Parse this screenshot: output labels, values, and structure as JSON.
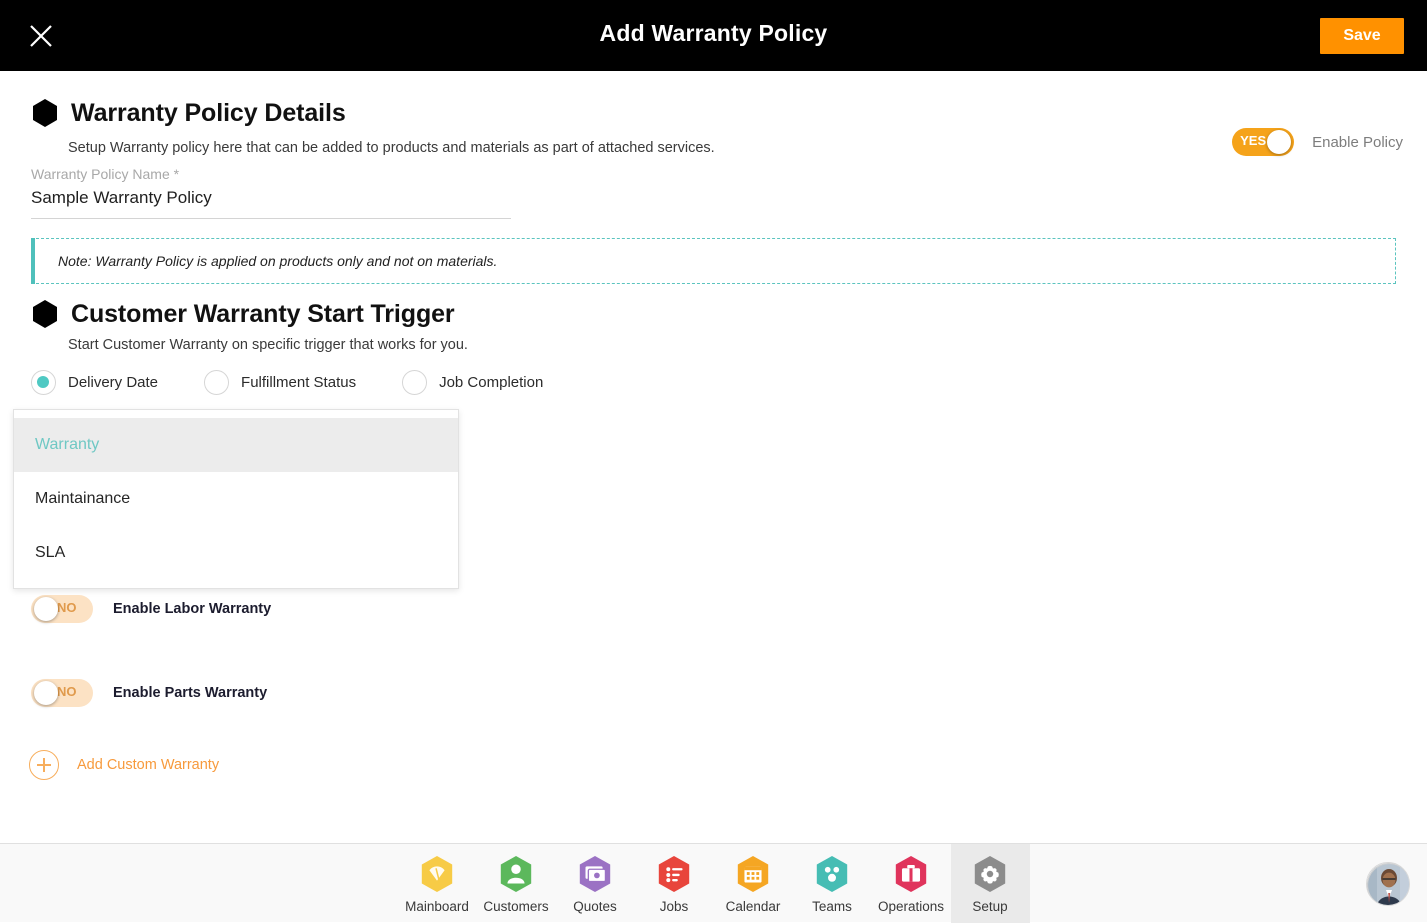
{
  "topbar": {
    "close_icon": "close-icon",
    "title": "Add Warranty Policy",
    "save_label": "Save"
  },
  "policy_details": {
    "heading": "Warranty Policy Details",
    "subtitle": "Setup Warranty policy here that can be added to products and materials as part of attached services.",
    "enable_toggle": {
      "state": "YES",
      "label": "Enable Policy"
    },
    "name_field": {
      "label": "Warranty Policy Name *",
      "value": "Sample Warranty Policy",
      "placeholder": "Warranty Policy Name"
    }
  },
  "note": {
    "text": "Note: Warranty Policy is applied on products only and not on materials.",
    "accent_color": "#4FC0BB"
  },
  "start_trigger": {
    "heading": "Customer Warranty Start Trigger",
    "subtitle": "Start Customer Warranty on specific trigger that works for you.",
    "options": [
      {
        "label": "Delivery Date",
        "selected": true
      },
      {
        "label": "Fulfillment Status",
        "selected": false
      },
      {
        "label": "Job Completion",
        "selected": false
      }
    ]
  },
  "dropdown": {
    "items": [
      {
        "label": "Warranty",
        "active": true
      },
      {
        "label": "Maintainance",
        "active": false
      },
      {
        "label": "SLA",
        "active": false
      }
    ]
  },
  "warranty_toggles": [
    {
      "state": "NO",
      "label": "Enable Labor Warranty"
    },
    {
      "state": "NO",
      "label": "Enable Parts Warranty"
    }
  ],
  "add_custom": {
    "icon": "plus-circle-icon",
    "label": "Add Custom Warranty"
  },
  "bottom_nav": {
    "items": [
      {
        "label": "Mainboard",
        "icon": "mainboard-icon",
        "color": "#F7CB46",
        "active": false
      },
      {
        "label": "Customers",
        "icon": "customers-icon",
        "color": "#5CB85C",
        "active": false
      },
      {
        "label": "Quotes",
        "icon": "quotes-icon",
        "color": "#9B72C4",
        "active": false
      },
      {
        "label": "Jobs",
        "icon": "jobs-icon",
        "color": "#E8453C",
        "active": false
      },
      {
        "label": "Calendar",
        "icon": "calendar-icon",
        "color": "#F5A623",
        "active": false
      },
      {
        "label": "Teams",
        "icon": "teams-icon",
        "color": "#46BDB4",
        "active": false
      },
      {
        "label": "Operations",
        "icon": "operations-icon",
        "color": "#E0345C",
        "active": false
      },
      {
        "label": "Setup",
        "icon": "setup-gear-icon",
        "color": "#8C8C8C",
        "active": true
      }
    ],
    "avatar": "user-avatar"
  },
  "colors": {
    "accent_orange": "#FF9100",
    "accent_teal": "#4FC9C3",
    "toggle_on": "#F5A31A",
    "toggle_off": "#FCE2C4"
  }
}
